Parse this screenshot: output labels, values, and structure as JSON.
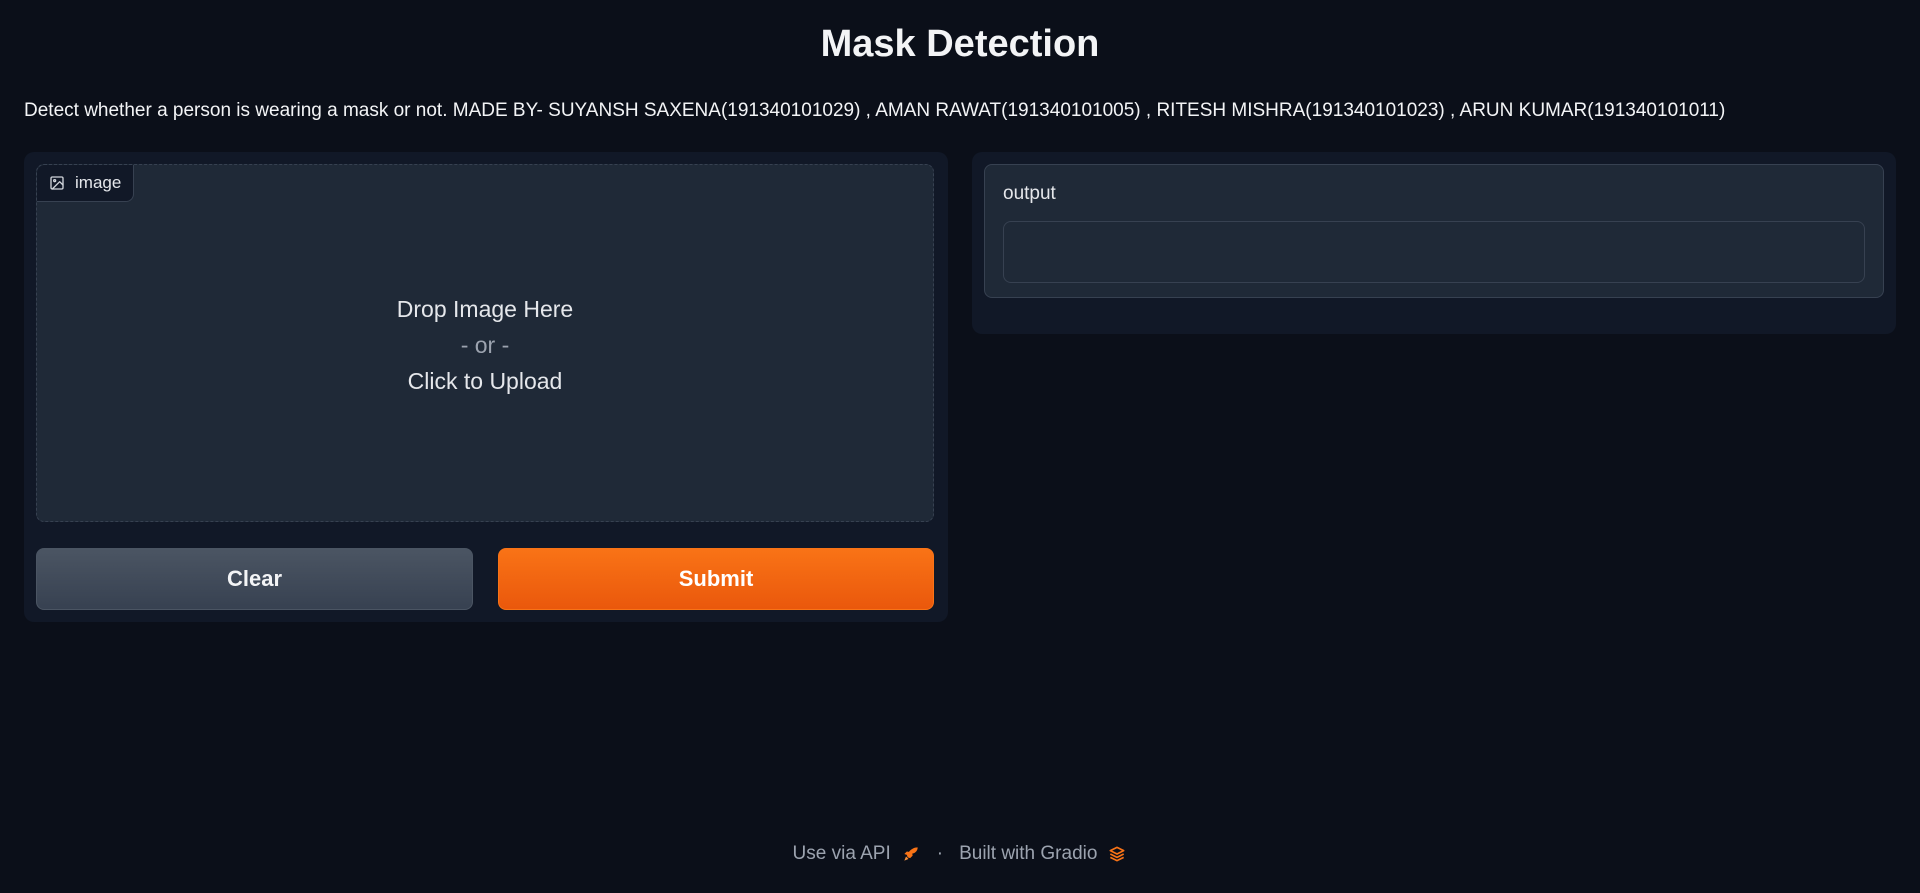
{
  "header": {
    "title": "Mask Detection",
    "description": "Detect whether a person is wearing a mask or not. MADE BY- SUYANSH SAXENA(191340101029) , AMAN RAWAT(191340101005) , RITESH MISHRA(191340101023) , ARUN KUMAR(191340101011)"
  },
  "input": {
    "label": "image",
    "drop_text": "Drop Image Here",
    "or_text": "- or -",
    "upload_text": "Click to Upload"
  },
  "buttons": {
    "clear": "Clear",
    "submit": "Submit"
  },
  "output": {
    "label": "output",
    "value": ""
  },
  "footer": {
    "api_text": "Use via API",
    "separator": "·",
    "built_text": "Built with Gradio"
  },
  "colors": {
    "background": "#0b0f19",
    "panel": "#111827",
    "block": "#1f2937",
    "accent": "#f97316",
    "secondary_button": "#4b5563"
  }
}
